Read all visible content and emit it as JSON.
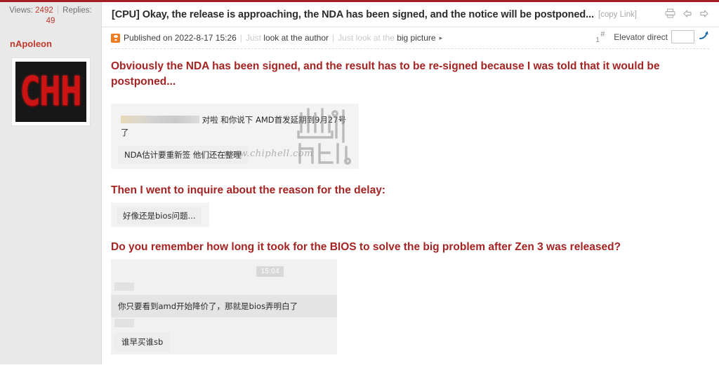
{
  "header": {
    "views_label": "Views:",
    "views_count": "2492",
    "replies_label": "Replies:",
    "replies_count": "49",
    "thread_title": "[CPU] Okay, the release is approaching, the NDA has been signed, and the notice will be postponed...",
    "copy_link": "[copy Link]",
    "icons": {
      "print": "print-icon",
      "prev": "back-arrow-icon",
      "next": "forward-arrow-icon"
    }
  },
  "author": {
    "name": "nApoleon",
    "avatar_text": "CHH"
  },
  "post_meta": {
    "published": "Published on 2022-8-17 15:26",
    "divider": "|",
    "only_author_prefix": "Just",
    "only_author": "look at the author",
    "big_picture_prefix": "Just look at the",
    "big_picture": "big picture",
    "arrow": "▸",
    "floor_hash": "#",
    "floor_number": "1",
    "elevator_label": "Elevator direct",
    "elevator_value": "",
    "go_icon": "go-arrow-icon"
  },
  "post": {
    "heading_1": "Obviously the NDA has been signed, and the result has to be re-signed because I was told that it would be postponed...",
    "heading_2": "Then I went to inquire about the reason for the delay:",
    "heading_3": "Do you remember how long it took for the BIOS to solve the big problem after Zen 3 was released?"
  },
  "screenshot_1": {
    "message_1_text": "对啦 和你说下 AMD首发延期到9月27号了",
    "message_2_text": "NDA估计要重新签 他们还在整理",
    "watermark_url": "www.chiphell.com",
    "watermark_logo": "chiphell-logo"
  },
  "screenshot_2": {
    "message_1_text": "好像还是bios问题..."
  },
  "screenshot_3": {
    "timestamp": "15:04",
    "message_1_text": "你只要看到amd开始降价了，那就是bios弄明白了",
    "message_2_text": "谁早买谁sb"
  },
  "colors": {
    "accent_red": "#a51e22",
    "heading_red": "#a52423",
    "author_red": "#c0392b",
    "meta_orange": "#ef7b21",
    "link_blue": "#1868a8"
  }
}
